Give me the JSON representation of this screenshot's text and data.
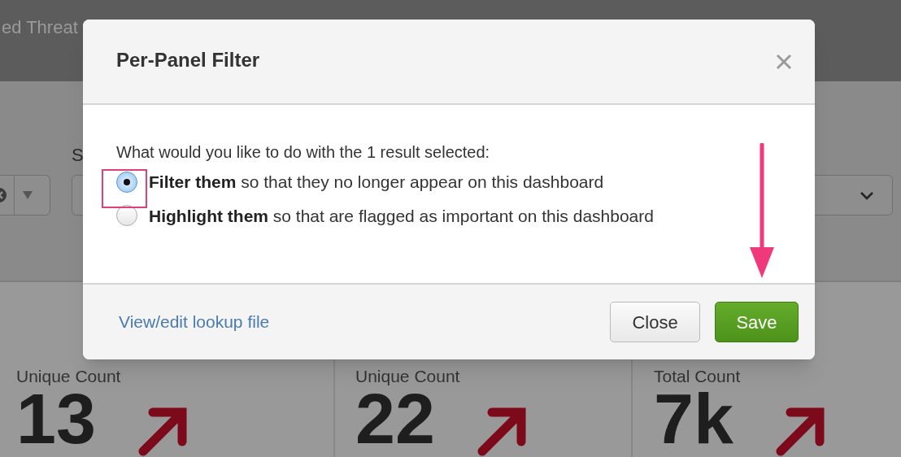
{
  "background": {
    "title_fragment": "ed Threat",
    "filter_label": "S",
    "panels": [
      {
        "subtitle": "Unique Count",
        "value": "13"
      },
      {
        "subtitle": "Unique Count",
        "value": "22"
      },
      {
        "subtitle": "Total Count",
        "value": "7k"
      }
    ]
  },
  "modal": {
    "title": "Per-Panel Filter",
    "question": "What would you like to do with the 1 result selected:",
    "options": [
      {
        "text": "**Filter them** so that they no longer appear on this dashboard",
        "selected": true
      },
      {
        "text": "**Highlight them** so that are flagged as important on this dashboard",
        "selected": false
      }
    ],
    "link": "View/edit lookup file",
    "buttons": [
      {
        "label": "Close",
        "kind": "secondary"
      },
      {
        "label": "Save",
        "kind": "primary"
      }
    ]
  }
}
